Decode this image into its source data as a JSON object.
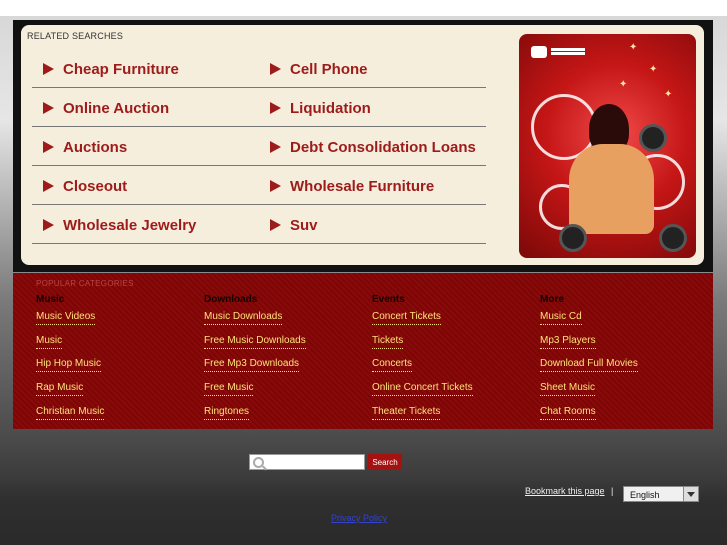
{
  "related": {
    "title": "RELATED SEARCHES",
    "rows": [
      [
        "Cheap Furniture",
        "Cell Phone"
      ],
      [
        "Online Auction",
        "Liquidation"
      ],
      [
        "Auctions",
        "Debt Consolidation Loans"
      ],
      [
        "Closeout",
        "Wholesale Furniture"
      ],
      [
        "Wholesale Jewelry",
        "Suv"
      ]
    ]
  },
  "categories": {
    "title": "POPULAR CATEGORIES",
    "columns": [
      {
        "head": "Music",
        "links": [
          "Music Videos",
          "Music",
          "Hip Hop Music",
          "Rap Music",
          "Christian Music"
        ]
      },
      {
        "head": "Downloads",
        "links": [
          "Music Downloads",
          "Free Music Downloads",
          "Free Mp3 Downloads",
          "Free Music",
          "Ringtones"
        ]
      },
      {
        "head": "Events",
        "links": [
          "Concert Tickets",
          "Tickets",
          "Concerts",
          "Online Concert Tickets",
          "Theater Tickets"
        ]
      },
      {
        "head": "More",
        "links": [
          "Music Cd",
          "Mp3 Players",
          "Download Full Movies",
          "Sheet Music",
          "Chat Rooms"
        ]
      }
    ]
  },
  "search": {
    "placeholder": "",
    "button": "Search"
  },
  "footer": {
    "bookmark": "Bookmark this page",
    "separator": "|",
    "language": "English",
    "privacy": "Privacy Policy"
  },
  "colors": {
    "accent": "#9e1b1b",
    "link_yellow": "#ffe27a",
    "category_bg": "#8a0a0a"
  }
}
